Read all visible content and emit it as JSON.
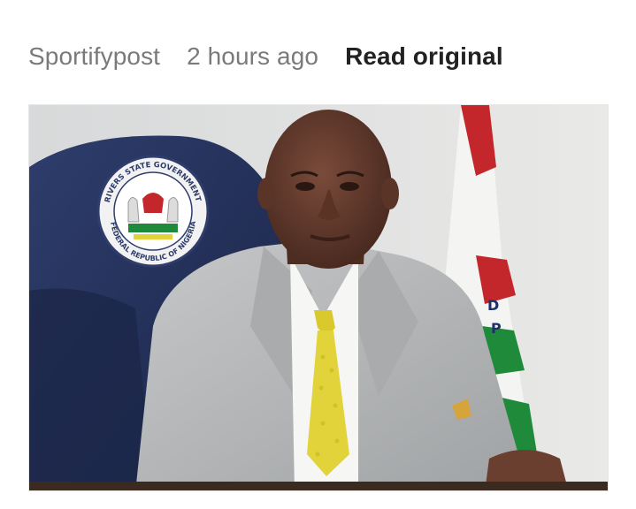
{
  "article_meta": {
    "source": "Sportifypost",
    "time_ago": "2 hours ago",
    "read_original_label": "Read original"
  },
  "photo": {
    "seal_text_top": "RIVERS STATE GOVERNMENT",
    "seal_text_bottom": "FEDERAL REPUBLIC OF NIGERIA",
    "colors": {
      "chair": "#24325c",
      "suit": "#b7b9ba",
      "tie": "#e2d33a",
      "flag_red": "#c4272b",
      "flag_green": "#1f8a3a"
    }
  }
}
